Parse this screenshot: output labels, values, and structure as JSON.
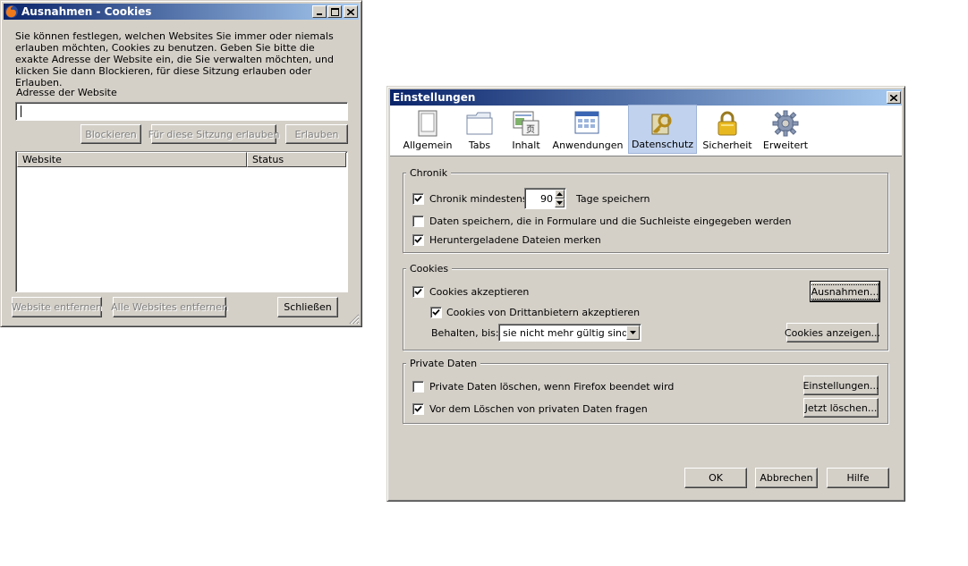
{
  "cookie_window": {
    "title": "Ausnahmen - Cookies",
    "description": "Sie können festlegen, welchen Websites Sie immer oder niemals erlauben möchten, Cookies zu benutzen. Geben Sie bitte die exakte Adresse der Website ein, die Sie verwalten möchten, und klicken Sie dann Blockieren, für diese Sitzung erlauben oder Erlauben.",
    "address_label": "Adresse der Website",
    "address_value": "",
    "block_button": "Blockieren",
    "session_button": "Für diese Sitzung erlauben",
    "allow_button": "Erlauben",
    "columns": [
      "Website",
      "Status"
    ],
    "remove_site_button": "Website entfernen",
    "remove_all_button": "Alle Websites entfernen",
    "close_button": "Schließen"
  },
  "settings_window": {
    "title": "Einstellungen",
    "tabs": [
      {
        "label": "Allgemein",
        "icon": "general-icon"
      },
      {
        "label": "Tabs",
        "icon": "tabs-icon"
      },
      {
        "label": "Inhalt",
        "icon": "content-icon"
      },
      {
        "label": "Anwendungen",
        "icon": "applications-icon"
      },
      {
        "label": "Datenschutz",
        "icon": "privacy-icon",
        "active": true
      },
      {
        "label": "Sicherheit",
        "icon": "lock-icon"
      },
      {
        "label": "Erweitert",
        "icon": "gear-icon"
      }
    ],
    "history": {
      "title": "Chronik",
      "keep_prefix": "Chronik mindestens",
      "keep_days": "90",
      "keep_suffix": "Tage speichern",
      "save_forms": "Daten speichern, die in Formulare und die Suchleiste eingegeben werden",
      "remember_downloads": "Heruntergeladene Dateien merken"
    },
    "cookies": {
      "title": "Cookies",
      "accept": "Cookies akzeptieren",
      "exceptions_button": "Ausnahmen...",
      "third_party": "Cookies von Drittanbietern akzeptieren",
      "keep_until_label": "Behalten, bis:",
      "keep_until_value": "sie nicht mehr gültig sind",
      "show_cookies_button": "Cookies anzeigen..."
    },
    "private_data": {
      "title": "Private Daten",
      "clear_on_exit": "Private Daten löschen, wenn Firefox beendet wird",
      "settings_button": "Einstellungen...",
      "ask_before": "Vor dem Löschen von privaten Daten fragen",
      "clear_now_button": "Jetzt löschen..."
    },
    "ok_button": "OK",
    "cancel_button": "Abbrechen",
    "help_button": "Hilfe"
  },
  "colors": {
    "titlebar_start": "#0a246a",
    "titlebar_end": "#a6caf0",
    "face": "#d4d0c8",
    "active_tab": "#c1d2ee"
  }
}
